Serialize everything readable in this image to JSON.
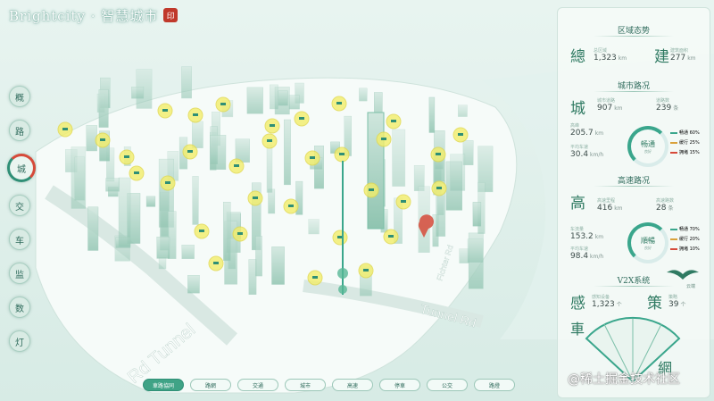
{
  "header": {
    "title": "Brightcity · 智慧城市",
    "seal": "印"
  },
  "side_nav": [
    {
      "label": "概"
    },
    {
      "label": "路"
    },
    {
      "label": "城",
      "active": true
    },
    {
      "label": "交"
    },
    {
      "label": "车"
    },
    {
      "label": "监"
    },
    {
      "label": "数"
    },
    {
      "label": "灯"
    }
  ],
  "road_labels": [
    "Rd Tunnel",
    "Fichter Rd",
    "Tunnel Rd"
  ],
  "panel": {
    "region": {
      "title": "区域态势",
      "char_left": "總",
      "char_right": "建",
      "stat_left": {
        "label": "总区域",
        "value": "1,323",
        "unit": "km"
      },
      "stat_right": {
        "label": "建筑面积",
        "value": "277",
        "unit": "km"
      }
    },
    "city_road": {
      "title": "城市路况",
      "char": "城",
      "stat_a": {
        "label": "城市道路",
        "value": "907",
        "unit": "km"
      },
      "stat_b": {
        "label": "道路数",
        "value": "239",
        "unit": "条"
      },
      "stat_c": {
        "label": "高峰",
        "value": "205.7",
        "unit": "km"
      },
      "stat_d": {
        "label": "平均车速",
        "value": "30.4",
        "unit": "km/h"
      },
      "ring": {
        "value": "畅通",
        "sub": "良好"
      },
      "legend": [
        {
          "label": "畅通 60%",
          "color": "#3aa68c"
        },
        {
          "label": "缓行 25%",
          "color": "#d9a13b"
        },
        {
          "label": "拥堵 15%",
          "color": "#d64a3a"
        }
      ]
    },
    "highway": {
      "title": "高速路况",
      "char": "高",
      "stat_a": {
        "label": "高速里程",
        "value": "416",
        "unit": "km"
      },
      "stat_b": {
        "label": "高速路数",
        "value": "28",
        "unit": "条"
      },
      "stat_c": {
        "label": "车流量",
        "value": "153.2",
        "unit": "km"
      },
      "stat_d": {
        "label": "平均车速",
        "value": "98.4",
        "unit": "km/h"
      },
      "ring": {
        "value": "順暢",
        "sub": "良好"
      },
      "legend": [
        {
          "label": "畅通 70%",
          "color": "#3aa68c"
        },
        {
          "label": "缓行 20%",
          "color": "#d9a13b"
        },
        {
          "label": "拥堵 10%",
          "color": "#d64a3a"
        }
      ]
    },
    "v2x": {
      "title": "V2X系统",
      "char_left": "感",
      "char_right": "策",
      "stat_left": {
        "label": "感知设备",
        "value": "1,323",
        "unit": "个"
      },
      "stat_right": {
        "label": "策略",
        "value": "39",
        "unit": "个"
      },
      "bird_note": "云端"
    },
    "fan": {
      "char_top": "車",
      "char_bottom": "網"
    }
  },
  "bottom_nav": [
    {
      "label": "車路協同",
      "active": true
    },
    {
      "label": "路網"
    },
    {
      "label": "交通"
    },
    {
      "label": "城市"
    },
    {
      "label": "高速"
    },
    {
      "label": "停車"
    },
    {
      "label": "公交"
    },
    {
      "label": "路燈"
    }
  ],
  "watermark": "@稀土掘金技术社区",
  "colors": {
    "accent": "#2f8f76",
    "alert": "#d64a3a",
    "marker": "#f3ee6a"
  }
}
